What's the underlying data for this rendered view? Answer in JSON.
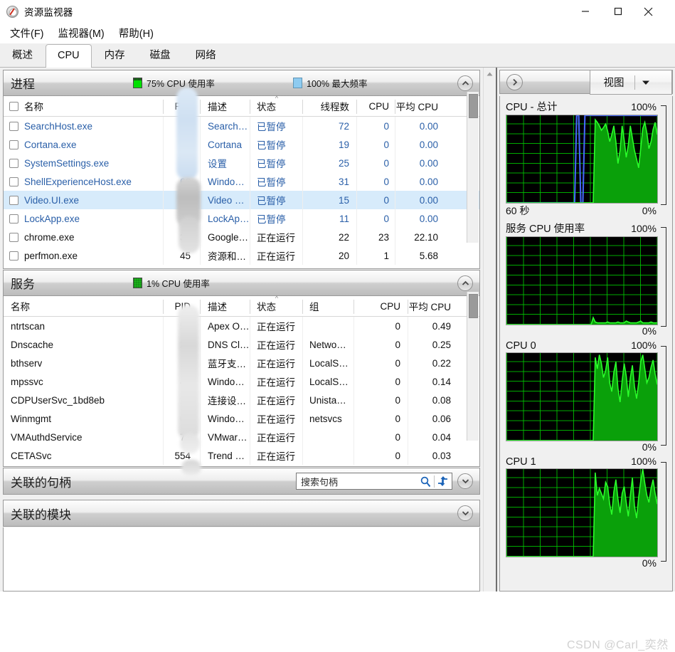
{
  "window": {
    "title": "资源监视器",
    "icon": "resource-monitor-icon",
    "minimize": "—",
    "maximize": "□",
    "close": "×"
  },
  "menubar": {
    "items": [
      {
        "label": "文件(F)"
      },
      {
        "label": "监视器(M)"
      },
      {
        "label": "帮助(H)"
      }
    ]
  },
  "tabs": [
    {
      "label": "概述",
      "active": false
    },
    {
      "label": "CPU",
      "active": true
    },
    {
      "label": "内存",
      "active": false
    },
    {
      "label": "磁盘",
      "active": false
    },
    {
      "label": "网络",
      "active": false
    }
  ],
  "processes_panel": {
    "title": "进程",
    "legend_cpu": "75% CPU 使用率",
    "legend_freq": "100% 最大频率",
    "collapse_icon": "chevron-up-icon",
    "columns": [
      "名称",
      "PID",
      "描述",
      "状态",
      "线程数",
      "CPU",
      "平均 CPU"
    ],
    "sorted_column": "状态",
    "rows": [
      {
        "name": "SearchHost.exe",
        "pid": "1",
        "desc": "Search…",
        "state": "已暂停",
        "threads": "72",
        "cpu": "0",
        "avg": "0.00",
        "suspended": true,
        "selected": false
      },
      {
        "name": "Cortana.exe",
        "pid": "21",
        "desc": "Cortana",
        "state": "已暂停",
        "threads": "19",
        "cpu": "0",
        "avg": "0.00",
        "suspended": true,
        "selected": false
      },
      {
        "name": "SystemSettings.exe",
        "pid": "23",
        "desc": "设置",
        "state": "已暂停",
        "threads": "25",
        "cpu": "0",
        "avg": "0.00",
        "suspended": true,
        "selected": false
      },
      {
        "name": "ShellExperienceHost.exe",
        "pid": "66",
        "desc": "Windo…",
        "state": "已暂停",
        "threads": "31",
        "cpu": "0",
        "avg": "0.00",
        "suspended": true,
        "selected": false
      },
      {
        "name": "Video.UI.exe",
        "pid": "15",
        "desc": "Video …",
        "state": "已暂停",
        "threads": "15",
        "cpu": "0",
        "avg": "0.00",
        "suspended": true,
        "selected": true
      },
      {
        "name": "LockApp.exe",
        "pid": "46",
        "desc": "LockAp…",
        "state": "已暂停",
        "threads": "11",
        "cpu": "0",
        "avg": "0.00",
        "suspended": true,
        "selected": false
      },
      {
        "name": "chrome.exe",
        "pid": "36",
        "desc": "Google…",
        "state": "正在运行",
        "threads": "22",
        "cpu": "23",
        "avg": "22.10",
        "suspended": false,
        "selected": false
      },
      {
        "name": "perfmon.exe",
        "pid": "45",
        "desc": "资源和…",
        "state": "正在运行",
        "threads": "20",
        "cpu": "1",
        "avg": "5.68",
        "suspended": false,
        "selected": false
      }
    ]
  },
  "services_panel": {
    "title": "服务",
    "legend_cpu": "1% CPU 使用率",
    "collapse_icon": "chevron-up-icon",
    "columns": [
      "名称",
      "PID",
      "描述",
      "状态",
      "组",
      "CPU",
      "平均 CPU"
    ],
    "sorted_column": "状态",
    "rows": [
      {
        "name": "ntrtscan",
        "pid": "58",
        "desc": "Apex O…",
        "state": "正在运行",
        "group": "",
        "cpu": "0",
        "avg": "0.49"
      },
      {
        "name": "Dnscache",
        "pid": "28",
        "desc": "DNS Cl…",
        "state": "正在运行",
        "group": "Netwo…",
        "cpu": "0",
        "avg": "0.25"
      },
      {
        "name": "bthserv",
        "pid": "15",
        "desc": "蓝牙支…",
        "state": "正在运行",
        "group": "LocalS…",
        "cpu": "0",
        "avg": "0.22"
      },
      {
        "name": "mpssvc",
        "pid": "40",
        "desc": "Windo…",
        "state": "正在运行",
        "group": "LocalS…",
        "cpu": "0",
        "avg": "0.14"
      },
      {
        "name": "CDPUserSvc_1bd8eb",
        "pid": "17",
        "desc": "连接设…",
        "state": "正在运行",
        "group": "Unista…",
        "cpu": "0",
        "avg": "0.08"
      },
      {
        "name": "Winmgmt",
        "pid": "61",
        "desc": "Windo…",
        "state": "正在运行",
        "group": "netsvcs",
        "cpu": "0",
        "avg": "0.06"
      },
      {
        "name": "VMAuthdService",
        "pid": "73",
        "desc": "VMwar…",
        "state": "正在运行",
        "group": "",
        "cpu": "0",
        "avg": "0.04"
      },
      {
        "name": "CETASvc",
        "pid": "554",
        "desc": "Trend …",
        "state": "正在运行",
        "group": "",
        "cpu": "0",
        "avg": "0.03"
      }
    ]
  },
  "handles_panel": {
    "title": "关联的句柄",
    "search_placeholder": "搜索句柄",
    "search_value": "",
    "search_icon": "magnifier-icon",
    "refresh_icon": "refresh-arrows-icon",
    "collapse_icon": "chevron-down-icon"
  },
  "modules_panel": {
    "title": "关联的模块",
    "collapse_icon": "chevron-down-icon"
  },
  "graph_sidebar": {
    "expand_icon": "chevron-right-icon",
    "view_button": "视图",
    "view_dropdown_icon": "chevron-down-icon"
  },
  "watermark": "CSDN @Carl_奕然",
  "colors": {
    "cpu_green": "#00e000",
    "max_freq_blue": "#8ecbf0",
    "graph_fill": "#0aa00a",
    "graph_line": "#2bff2b",
    "graph_grid": "#00c800",
    "selection": "#d7ebfb",
    "suspended_text": "#2a5fa8"
  },
  "chart_data": [
    {
      "type": "area",
      "title": "CPU - 总计",
      "ymax_label": "100%",
      "ymin_label": "0%",
      "xlabel": "60 秒",
      "ylim": [
        0,
        100
      ],
      "grid": true,
      "series": [
        {
          "name": "CPU 总使用率",
          "values": [
            0,
            0,
            0,
            0,
            0,
            0,
            0,
            0,
            0,
            0,
            0,
            0,
            0,
            0,
            0,
            0,
            0,
            0,
            0,
            0,
            0,
            0,
            0,
            0,
            0,
            0,
            0,
            0,
            0,
            0,
            0,
            0,
            0,
            0,
            0,
            0,
            0,
            0,
            0,
            0,
            0,
            0,
            0,
            95,
            92,
            88,
            83,
            86,
            90,
            82,
            70,
            78,
            88,
            70,
            45,
            60,
            88,
            72,
            52,
            66,
            88,
            74,
            60,
            50,
            40,
            62,
            85,
            92,
            80,
            62,
            70,
            84,
            92,
            78
          ]
        },
        {
          "name": "最大频率",
          "values": [
            0,
            0,
            0,
            0,
            0,
            0,
            0,
            0,
            0,
            0,
            0,
            0,
            0,
            0,
            0,
            0,
            0,
            0,
            0,
            0,
            0,
            0,
            0,
            0,
            0,
            0,
            0,
            0,
            0,
            0,
            0,
            0,
            0,
            0,
            100,
            100,
            0,
            0,
            100,
            100,
            100,
            100,
            100,
            100,
            100,
            100,
            100,
            100,
            100,
            100,
            100,
            100,
            100,
            100,
            100,
            100,
            100,
            100,
            100,
            100,
            100,
            100,
            100,
            100,
            100,
            100,
            100,
            100,
            100,
            100,
            100,
            100,
            100,
            100
          ]
        }
      ]
    },
    {
      "type": "area",
      "title": "服务 CPU 使用率",
      "ymax_label": "100%",
      "ymin_label": "0%",
      "ylim": [
        0,
        100
      ],
      "grid": true,
      "series": [
        {
          "name": "服务 CPU",
          "values": [
            0,
            0,
            0,
            0,
            0,
            0,
            0,
            0,
            0,
            0,
            0,
            0,
            0,
            0,
            0,
            0,
            0,
            0,
            0,
            0,
            0,
            0,
            0,
            0,
            0,
            0,
            0,
            0,
            0,
            0,
            0,
            0,
            0,
            0,
            0,
            0,
            0,
            0,
            0,
            0,
            0,
            0,
            8,
            3,
            2,
            2,
            2,
            2,
            2,
            3,
            2,
            2,
            2,
            2,
            3,
            2,
            2,
            2,
            4,
            3,
            2,
            2,
            2,
            2,
            3,
            4,
            2,
            2,
            2,
            2,
            3,
            2,
            2,
            2
          ]
        }
      ]
    },
    {
      "type": "area",
      "title": "CPU 0",
      "ymax_label": "100%",
      "ymin_label": "0%",
      "ylim": [
        0,
        100
      ],
      "grid": true,
      "series": [
        {
          "name": "CPU 0",
          "values": [
            0,
            0,
            0,
            0,
            0,
            0,
            0,
            0,
            0,
            0,
            0,
            0,
            0,
            0,
            0,
            0,
            0,
            0,
            0,
            0,
            0,
            0,
            0,
            0,
            0,
            0,
            0,
            0,
            0,
            0,
            0,
            0,
            0,
            0,
            0,
            0,
            0,
            0,
            0,
            0,
            0,
            0,
            0,
            95,
            82,
            98,
            88,
            72,
            80,
            95,
            66,
            56,
            78,
            90,
            60,
            44,
            68,
            88,
            74,
            50,
            72,
            86,
            62,
            48,
            66,
            90,
            98,
            82,
            66,
            72,
            84,
            92,
            76,
            64
          ]
        }
      ]
    },
    {
      "type": "area",
      "title": "CPU 1",
      "ymax_label": "100%",
      "ymin_label": "0%",
      "ylim": [
        0,
        100
      ],
      "grid": true,
      "series": [
        {
          "name": "CPU 1",
          "values": [
            0,
            0,
            0,
            0,
            0,
            0,
            0,
            0,
            0,
            0,
            0,
            0,
            0,
            0,
            0,
            0,
            0,
            0,
            0,
            0,
            0,
            0,
            0,
            0,
            0,
            0,
            0,
            0,
            0,
            0,
            0,
            0,
            0,
            0,
            0,
            0,
            0,
            0,
            0,
            0,
            0,
            0,
            0,
            96,
            70,
            78,
            72,
            66,
            85,
            80,
            60,
            48,
            74,
            88,
            66,
            50,
            72,
            80,
            62,
            46,
            70,
            90,
            58,
            44,
            68,
            86,
            100,
            84,
            70,
            62,
            78,
            88,
            72,
            60
          ]
        }
      ]
    }
  ]
}
